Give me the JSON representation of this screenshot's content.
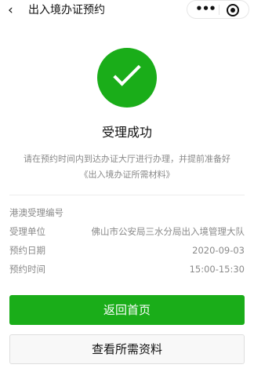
{
  "nav": {
    "back_icon": "chevron-left-icon",
    "title": "出入境办证预约",
    "more_icon": "more-dots-icon",
    "more_glyph": "•••",
    "close_icon": "target-close-icon"
  },
  "result": {
    "icon": "success-check-icon",
    "icon_color": "#1aad19",
    "title": "受理成功",
    "desc_line1": "请在预约时间内到达办证大厅进行办理，并提前准备好",
    "desc_line2": "《出入境办证所需材料》"
  },
  "info": [
    {
      "label": "港澳受理编号",
      "value": ""
    },
    {
      "label": "受理单位",
      "value": "佛山市公安局三水分局出入境管理大队"
    },
    {
      "label": "预约日期",
      "value": "2020-09-03"
    },
    {
      "label": "预约时间",
      "value": "15:00-15:30"
    }
  ],
  "buttons": {
    "primary_label": "返回首页",
    "primary_color": "#1aad19",
    "secondary_label": "查看所需资料"
  }
}
